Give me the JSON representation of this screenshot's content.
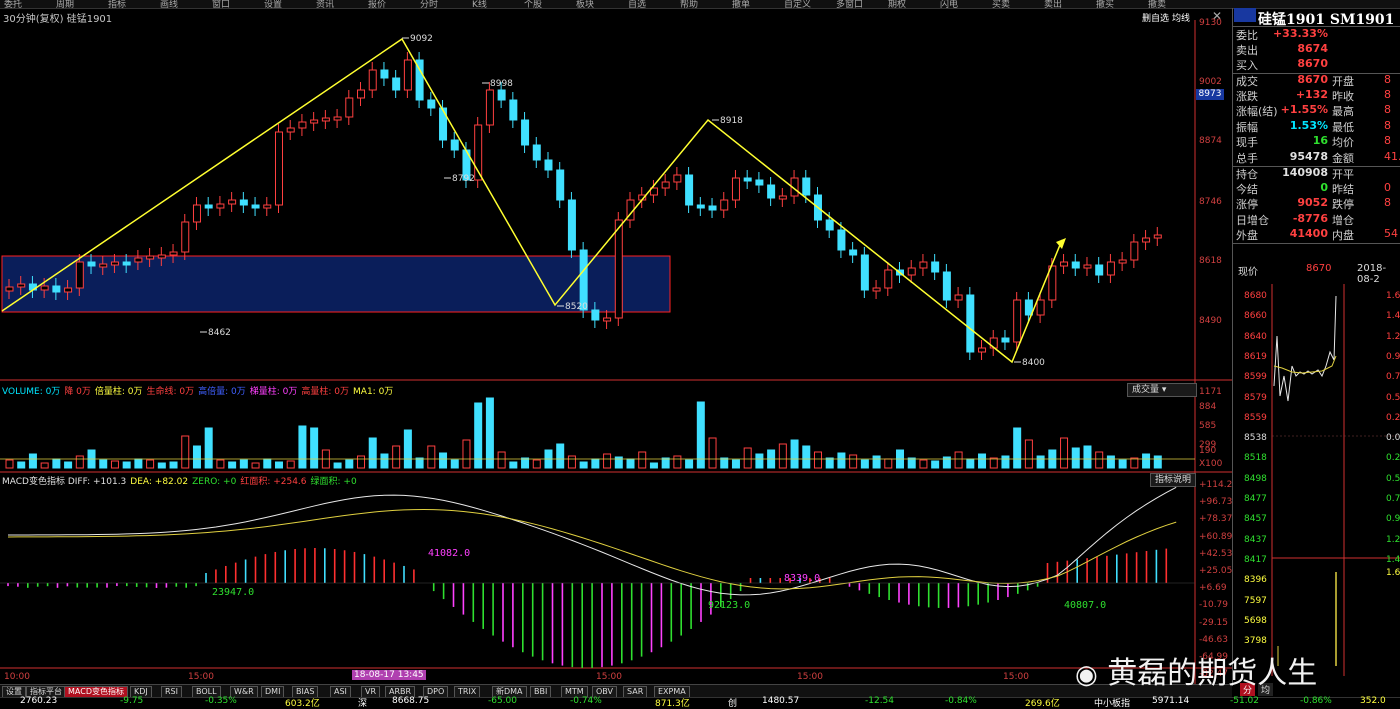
{
  "toolbar": {
    "items": [
      "委托",
      "周期",
      "指标",
      "画线",
      "窗口",
      "设置",
      "资讯",
      "报价",
      "分时",
      "K线",
      "个股",
      "板块",
      "自选",
      "帮助",
      "撤单",
      "自定义",
      "多窗口",
      "期权",
      "闪电",
      "买卖",
      "卖出",
      "撤买",
      "撤卖"
    ]
  },
  "kline": {
    "title": "30分钟(复权) 硅锰1901",
    "buttons": {
      "zixuan": "删自选",
      "junxian": "均线"
    },
    "price_axis": [
      "9130",
      "9002",
      "8874",
      "8746",
      "8618",
      "8490"
    ],
    "highlight_price": "8973",
    "annotations": [
      "9092",
      "8998",
      "8918",
      "8792",
      "8520",
      "8462",
      "8400"
    ],
    "time_axis": [
      "10:00",
      "15:00",
      "18-08-17 13:45",
      "15:00",
      "15:00",
      "15:00"
    ],
    "zone_color": "#0a1e5a",
    "zone_border": "#ff2020"
  },
  "volume": {
    "legend": [
      {
        "text": "VOLUME: 0万",
        "color": "#00e6ff"
      },
      {
        "text": "降 0万",
        "color": "#ff4040"
      },
      {
        "text": "倍量柱: 0万",
        "color": "#ffff40"
      },
      {
        "text": "生命线: 0万",
        "color": "#ff4040"
      },
      {
        "text": "高倍量: 0万",
        "color": "#4060ff"
      },
      {
        "text": "梯量柱: 0万",
        "color": "#ff40ff"
      },
      {
        "text": "高量柱: 0万",
        "color": "#ff4040"
      },
      {
        "text": "MA1: 0万",
        "color": "#ffff40"
      }
    ],
    "dropdown": "成交量",
    "axis": [
      "1171",
      "884",
      "585",
      "299",
      "190",
      "X100"
    ]
  },
  "macd": {
    "legend": [
      {
        "text": "MACD变色指标 DIFF: +101.3",
        "color": "#e0e0e0"
      },
      {
        "text": "DEA: +82.02",
        "color": "#ffff40"
      },
      {
        "text": "ZERO: +0",
        "color": "#2fe02f"
      },
      {
        "text": "红面积: +254.6",
        "color": "#ff4040"
      },
      {
        "text": "绿面积: +0",
        "color": "#2fe02f"
      }
    ],
    "button": "指标说明",
    "axis": [
      "+114.2",
      "+96.73",
      "+78.37",
      "+60.89",
      "+42.53",
      "+25.05",
      "+6.69",
      "-10.79",
      "-29.15",
      "-46.63",
      "-64.99",
      "-82.47"
    ],
    "area_labels": [
      "41082.0",
      "23947.0",
      "8339.0",
      "92123.0",
      "40807.0"
    ]
  },
  "tabs": [
    "设置",
    "指标平台",
    "MACD变色指标",
    "KDJ",
    "RSI",
    "BOLL",
    "W&R",
    "DMI",
    "BIAS",
    "ASI",
    "VR",
    "ARBR",
    "DPO",
    "TRIX",
    "新DMA",
    "BBI",
    "MTM",
    "OBV",
    "SAR",
    "EXPMA"
  ],
  "active_tab": "MACD变色指标",
  "status": [
    "2760.23",
    "-9.75",
    "-0.35%",
    "603.2亿",
    "深",
    "8668.75",
    "-65.00",
    "-0.74%",
    "871.3亿",
    "创",
    "1480.57",
    "-12.54",
    "-0.84%",
    "269.6亿",
    "中小板指",
    "5971.14",
    "-51.02",
    "-0.86%",
    "352.0"
  ],
  "quote": {
    "title": "硅锰1901 SM1901",
    "rows": [
      {
        "l": "委比",
        "v": "+33.33%",
        "vc": "#ff4040"
      },
      {
        "l": "卖出",
        "v": "8674",
        "vc": "#ff4040"
      },
      {
        "l": "买入",
        "v": "8670",
        "vc": "#ff4040"
      },
      {
        "l": "成交",
        "v": "8670",
        "vc": "#ff4040",
        "l2": "开盘",
        "v2": "8"
      },
      {
        "l": "涨跌",
        "v": "+132",
        "vc": "#ff4040",
        "l2": "昨收",
        "v2": "8"
      },
      {
        "l": "涨幅(结)",
        "v": "+1.55%",
        "vc": "#ff4040",
        "l2": "最高",
        "v2": "8"
      },
      {
        "l": "振幅",
        "v": "1.53%",
        "vc": "#00e6ff",
        "l2": "最低",
        "v2": "8"
      },
      {
        "l": "现手",
        "v": "16",
        "vc": "#2fe02f",
        "l2": "均价",
        "v2": "8"
      },
      {
        "l": "总手",
        "v": "95478",
        "vc": "#e0e0e0",
        "l2": "金额",
        "v2": "41.1"
      },
      {
        "l": "持仓",
        "v": "140908",
        "vc": "#e0e0e0",
        "l2": "开平",
        "v2": ""
      },
      {
        "l": "今结",
        "v": "0",
        "vc": "#2fe02f",
        "l2": "昨结",
        "v2": "0"
      },
      {
        "l": "涨停",
        "v": "9052",
        "vc": "#ff4040",
        "l2": "跌停",
        "v2": "8"
      },
      {
        "l": "日增仓",
        "v": "-8776",
        "vc": "#ff4040",
        "l2": "增仓",
        "v2": ""
      },
      {
        "l": "外盘",
        "v": "41400",
        "vc": "#ff4040",
        "l2": "内盘",
        "v2": "54"
      }
    ],
    "now_label": "现价",
    "now_value": "8670",
    "date": "2018-08-2",
    "mini_left": [
      "8680",
      "8660",
      "8640",
      "8619",
      "8599",
      "8579",
      "8559",
      "8538",
      "8518",
      "8498",
      "8477",
      "8457",
      "8437",
      "8417",
      "8396",
      "7597",
      "5698",
      "3798"
    ],
    "mini_right": [
      "1.6",
      "1.4",
      "1.2",
      "0.9",
      "0.7",
      "0.5",
      "0.2",
      "0.00",
      "0.2",
      "0.5",
      "0.7",
      "0.9",
      "1.2",
      "1.4",
      "1.6"
    ],
    "bottom_tabs": [
      "分",
      "均"
    ]
  },
  "watermark": "黄磊的期货人生"
}
